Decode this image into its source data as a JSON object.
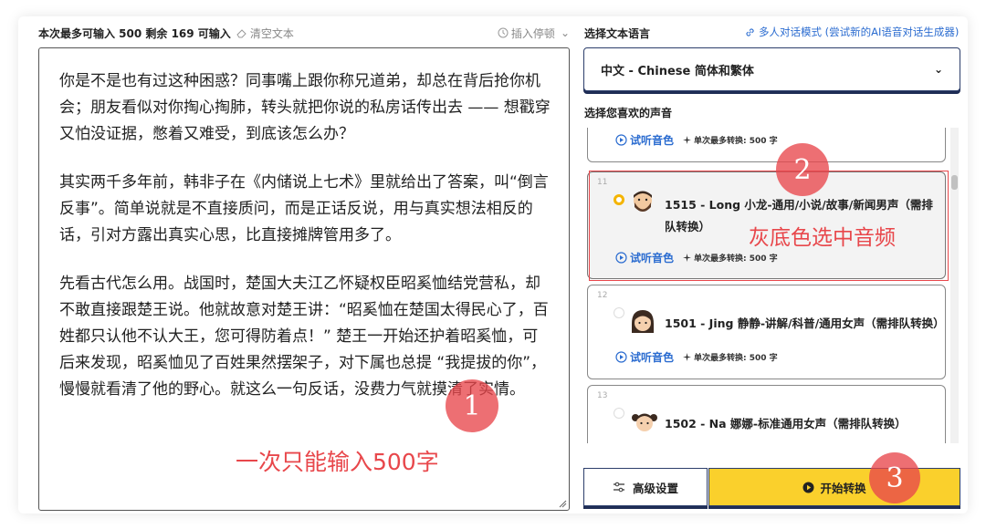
{
  "left": {
    "limit_text": "本次最多可输入 500 剩余 169 可输入",
    "clear_label": "清空文本",
    "insert_pause_label": "插入停顿",
    "paragraphs": [
      "你是不是也有过这种困惑？同事嘴上跟你称兄道弟，却总在背后抢你机会；朋友看似对你掏心掏肺，转头就把你说的私房话传出去 —— 想戳穿又怕没证据，憋着又难受，到底该怎么办？",
      "其实两千多年前，韩非子在《内储说上七术》里就给出了答案，叫“倒言反事”。简单说就是不直接质问，而是正话反说，用与真实想法相反的话，引对方露出真实心思，比直接摊牌管用多了。",
      "先看古代怎么用。战国时，楚国大夫江乙怀疑权臣昭奚恤结党营私，却不敢直接跟楚王说。他就故意对楚王讲：“昭奚恤在楚国太得民心了，百姓都只认他不认大王，您可得防着点！” 楚王一开始还护着昭奚恤，可后来发现，昭奚恤见了百姓果然摆架子，对下属也总提 “我提拔的你”，慢慢就看清了他的野心。就这么一句反话，没费力气就摸清了实情。"
    ],
    "annotation": "一次只能输入500字"
  },
  "right": {
    "language_label": "选择文本语言",
    "multi_mode_link": "多人对话模式 (尝试新的AI语音对话生成器)",
    "language_value": "中文 - Chinese 简体和繁体",
    "voice_label": "选择您喜欢的声音",
    "listen_label": "试听音色",
    "max_label": "单次最多转换: 500 字",
    "voices": [
      {
        "index": "11",
        "name": "1515 - Long 小龙-通用/小说/故事/新闻男声（需排队转换）",
        "selected": true
      },
      {
        "index": "12",
        "name": "1501 - Jing 静静-讲解/科普/通用女声（需排队转换）",
        "selected": false
      },
      {
        "index": "13",
        "name": "1502 - Na 娜娜-标准通用女声（需排队转换）",
        "selected": false
      }
    ],
    "annotation": "灰底色选中音频",
    "advanced_button": "高级设置",
    "start_button": "开始转换"
  },
  "markers": [
    "1",
    "2",
    "3"
  ],
  "colors": {
    "accent_red": "#e8474b",
    "start_yellow": "#fad02c",
    "link_blue": "#2b6cd0",
    "border_navy": "#2c3e6b"
  }
}
